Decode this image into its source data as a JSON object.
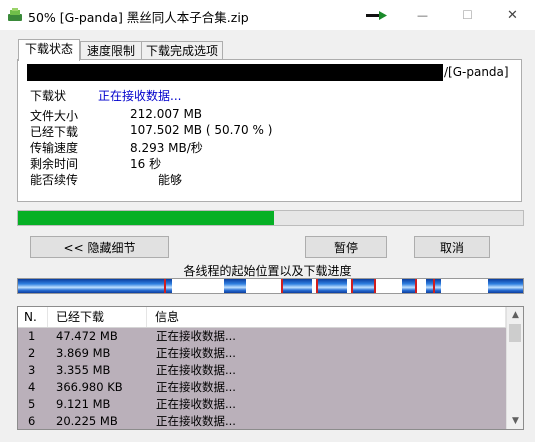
{
  "window": {
    "title": "50% [G-panda] 黑丝同人本子合集.zip",
    "controls": {
      "minimize": "—",
      "maximize": "☐",
      "close": "✕"
    },
    "icons": {
      "app": "download-app-icon",
      "network": "network-activity-icon"
    }
  },
  "tabs": [
    {
      "label": "下载状态",
      "active": true
    },
    {
      "label": "速度限制",
      "active": false
    },
    {
      "label": "下载完成选项",
      "active": false
    }
  ],
  "status": {
    "url_tail": "/[G-panda]",
    "state_label": "下载状",
    "state_value": "正在接收数据...",
    "rows": [
      {
        "label": "文件大小",
        "value": "212.007  MB"
      },
      {
        "label": "已经下载",
        "value": "107.502  MB  ( 50.70 % )"
      },
      {
        "label": "传输速度",
        "value": "8.293  MB/秒"
      },
      {
        "label": "剩余时间",
        "value": "16 秒"
      },
      {
        "label": "能否续传",
        "value": "能够"
      }
    ]
  },
  "progress": {
    "percent": 50.7,
    "color": "#06b025"
  },
  "buttons": {
    "hide_details": "<< 隐藏细节",
    "pause": "暂停",
    "cancel": "取消"
  },
  "threads": {
    "caption": "各线程的起始位置以及下载进度",
    "segments": [
      [
        0.0,
        0.305
      ],
      [
        0.407,
        0.452
      ],
      [
        0.52,
        0.583
      ],
      [
        0.595,
        0.652
      ],
      [
        0.662,
        0.705
      ],
      [
        0.76,
        0.787
      ],
      [
        0.808,
        0.838
      ],
      [
        0.93,
        1.0
      ]
    ],
    "markers": [
      0.29,
      0.52,
      0.59,
      0.66,
      0.705,
      0.787,
      0.822
    ],
    "colors": {
      "segment": "#2f7fe0",
      "marker": "#d01e1e"
    }
  },
  "list": {
    "headers": [
      "N.",
      "已经下载",
      "信息"
    ],
    "rows": [
      {
        "n": "1",
        "downloaded": "47.472  MB",
        "info": "正在接收数据..."
      },
      {
        "n": "2",
        "downloaded": "3.869  MB",
        "info": "正在接收数据..."
      },
      {
        "n": "3",
        "downloaded": "3.355  MB",
        "info": "正在接收数据..."
      },
      {
        "n": "4",
        "downloaded": "366.980  KB",
        "info": "正在接收数据..."
      },
      {
        "n": "5",
        "downloaded": "9.121  MB",
        "info": "正在接收数据..."
      },
      {
        "n": "6",
        "downloaded": "20.225  MB",
        "info": "正在接收数据..."
      }
    ],
    "scroll": {
      "up": "▲",
      "down": "▼"
    },
    "row_background": "#bab0ba"
  }
}
